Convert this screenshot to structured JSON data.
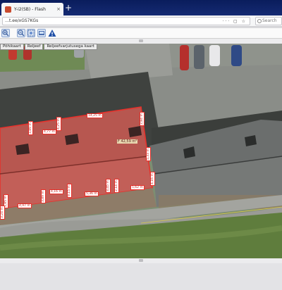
{
  "browser": {
    "tab_title": "Y-i2(SB) - Flash",
    "tab_close": "×",
    "new_tab": "+",
    "url": "…t.ee/xGS7KGs",
    "url_actions": "··· ▢ ☆",
    "search_placeholder": "Search",
    "tab_icon_color": "#c94a2e"
  },
  "toolbar": {
    "tools": [
      {
        "icon": "zoom-in-icon",
        "color": "#5580c4"
      },
      {
        "icon": "zoom-out-icon",
        "color": "#5580c4"
      },
      {
        "icon": "zoom-area-icon",
        "color": "#6a8fcf"
      },
      {
        "icon": "pan-icon",
        "color": "#4a6fb0"
      },
      {
        "icon": "warning-icon",
        "color": "#1f4fa6"
      }
    ]
  },
  "layer_tabs": [
    "Põhikaart",
    "Reljeef",
    "Reljeefvarjutusega kaart"
  ],
  "map": {
    "roof_label": "F 42,59 m²",
    "measurements": [
      "14,25 m",
      "4,77 m",
      "3,89 m",
      "4,25 m",
      "2,84 m",
      "5,33 m",
      "4,16 m",
      "3,45 m",
      "4,16 m",
      "5,36 m",
      "3,89 m",
      "9,15 m",
      "5,62 m",
      "4,97 m",
      "1,85 m",
      "2,14 m",
      "3,24 m"
    ],
    "colors": {
      "highlight": "#e8312b",
      "grass": "#6c8a45",
      "road": "#8a8e88"
    }
  }
}
